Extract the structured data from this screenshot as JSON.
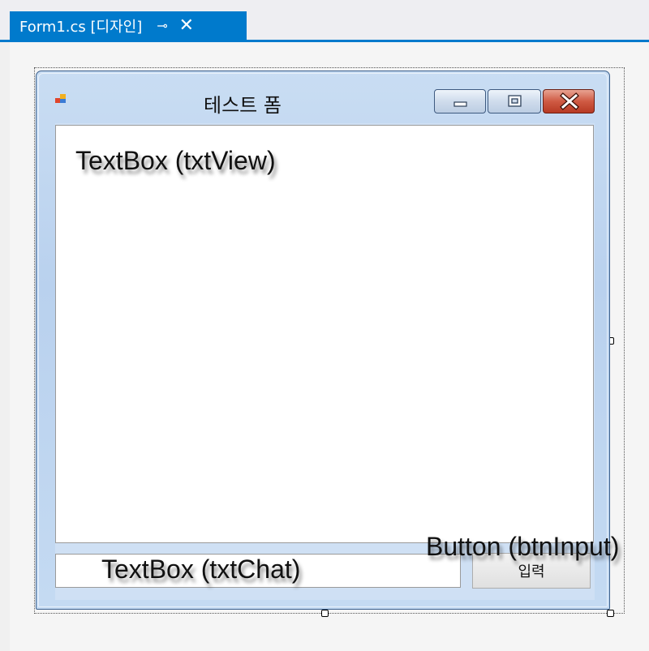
{
  "document_tab": {
    "title": "Form1.cs [디자인]",
    "pin_icon": "pin-icon",
    "close_icon": "close-icon"
  },
  "form": {
    "title": "테스트 폼",
    "caption_buttons": [
      "minimize-button",
      "maximize-button",
      "close-button"
    ]
  },
  "controls": {
    "button_label": "입력"
  },
  "annotations": {
    "txtview": "TextBox (txtView)",
    "txtchat": "TextBox (txtChat)",
    "btninput": "Button (btnInput)"
  },
  "colors": {
    "accent": "#007acc",
    "close_button": "#c9493a"
  }
}
